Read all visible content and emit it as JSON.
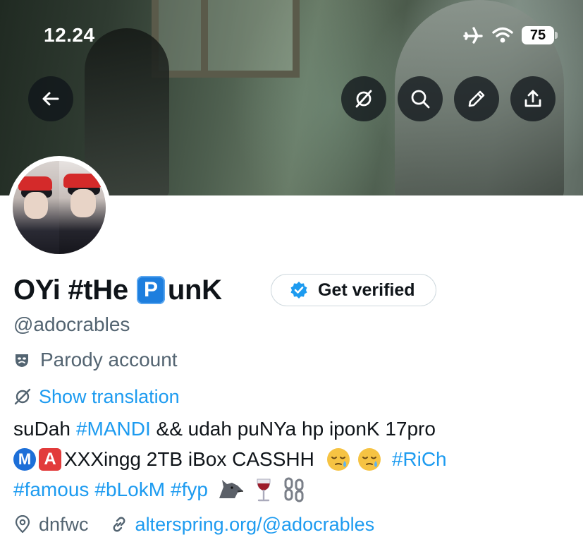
{
  "status_bar": {
    "time": "12.24",
    "battery": "75"
  },
  "profile": {
    "display_name_prefix": "OYi #tHe ",
    "display_name_badge": "P",
    "display_name_suffix": "unK",
    "verify_button_label": "Get verified",
    "handle": "@adocrables",
    "parody_label": "Parody account",
    "show_translation_label": "Show translation",
    "bio": {
      "line1_text1": "suDah ",
      "line1_tag1": "#MANDI",
      "line1_text2": " && udah puNYa hp iponK 17pro",
      "line2_m": "M",
      "line2_a": "A",
      "line2_text": "XXXingg 2TB iBox CASSHH",
      "line2_tag": "#RiCh",
      "line3_tag1": "#famous",
      "line3_tag2": "#bLokM",
      "line3_tag3": "#fyp"
    },
    "location": "dnfwc",
    "website": "alterspring.org/@adocrables"
  },
  "colors": {
    "accent": "#1d9bf0",
    "text": "#0f1419",
    "secondary": "#536471"
  },
  "icons": [
    "back-arrow-icon",
    "translate-icon",
    "search-icon",
    "edit-pencil-icon",
    "share-icon",
    "airplane-icon",
    "wifi-icon",
    "verified-badge-icon",
    "parody-mask-icon",
    "location-pin-icon",
    "link-icon"
  ]
}
